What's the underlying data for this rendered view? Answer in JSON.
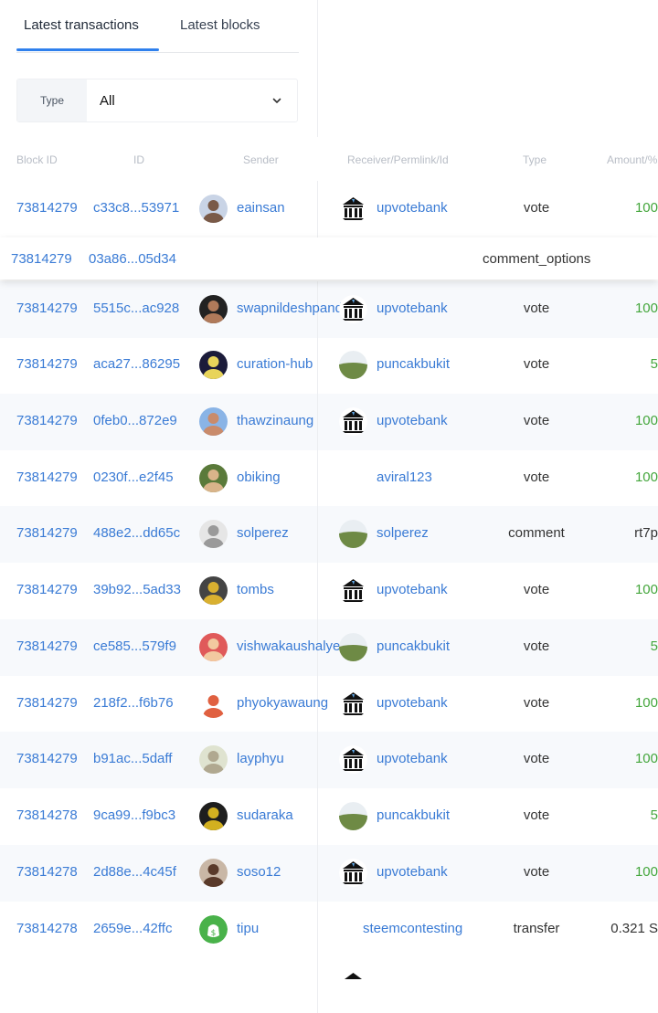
{
  "tabs": [
    {
      "label": "Latest transactions",
      "active": true
    },
    {
      "label": "Latest blocks",
      "active": false
    }
  ],
  "filter": {
    "label": "Type",
    "value": "All"
  },
  "columns": [
    "Block ID",
    "ID",
    "Sender",
    "Receiver/Permlink/Id",
    "Type",
    "Amount/%"
  ],
  "popup_row": {
    "block": "73814279",
    "id": "03a86...05d34",
    "type": "comment_options"
  },
  "rows": [
    {
      "block": "73814279",
      "id": "c33c8...53971",
      "sender": "eainsan",
      "receiver": "upvotebank",
      "type": "vote",
      "amount": "100"
    },
    {
      "block": "73814279",
      "id": "5515c...ac928",
      "sender": "swapnildeshpande",
      "receiver": "upvotebank",
      "type": "vote",
      "amount": "100"
    },
    {
      "block": "73814279",
      "id": "aca27...86295",
      "sender": "curation-hub",
      "receiver": "puncakbukit",
      "type": "vote",
      "amount": "5"
    },
    {
      "block": "73814279",
      "id": "0feb0...872e9",
      "sender": "thawzinaung",
      "receiver": "upvotebank",
      "type": "vote",
      "amount": "100"
    },
    {
      "block": "73814279",
      "id": "0230f...e2f45",
      "sender": "obiking",
      "receiver": "aviral123",
      "type": "vote",
      "amount": "100"
    },
    {
      "block": "73814279",
      "id": "488e2...dd65c",
      "sender": "solperez",
      "receiver": "solperez",
      "type": "comment",
      "amount": "rt7p"
    },
    {
      "block": "73814279",
      "id": "39b92...5ad33",
      "sender": "tombs",
      "receiver": "upvotebank",
      "type": "vote",
      "amount": "100"
    },
    {
      "block": "73814279",
      "id": "ce585...579f9",
      "sender": "vishwakaushalyeha",
      "receiver": "puncakbukit",
      "type": "vote",
      "amount": "5"
    },
    {
      "block": "73814279",
      "id": "218f2...f6b76",
      "sender": "phyokyawaung",
      "receiver": "upvotebank",
      "type": "vote",
      "amount": "100"
    },
    {
      "block": "73814279",
      "id": "b91ac...5daff",
      "sender": "layphyu",
      "receiver": "upvotebank",
      "type": "vote",
      "amount": "100"
    },
    {
      "block": "73814278",
      "id": "9ca99...f9bc3",
      "sender": "sudaraka",
      "receiver": "puncakbukit",
      "type": "vote",
      "amount": "5"
    },
    {
      "block": "73814278",
      "id": "2d88e...4c45f",
      "sender": "soso12",
      "receiver": "upvotebank",
      "type": "vote",
      "amount": "100"
    },
    {
      "block": "73814278",
      "id": "2659e...42ffc",
      "sender": "tipu",
      "receiver": "steemcontesting",
      "type": "transfer",
      "amount": "0.321 S"
    }
  ],
  "colors": {
    "accent": "#2f80ed",
    "link": "#3a7bd5",
    "positive": "#44a63c"
  }
}
